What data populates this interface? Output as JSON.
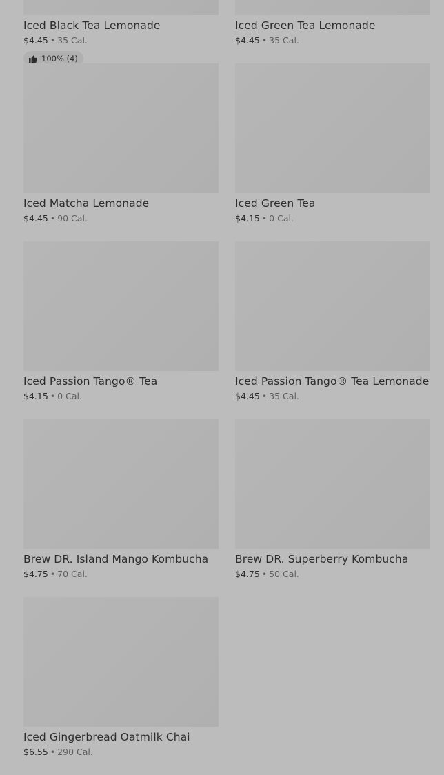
{
  "colors": {
    "background": "#bcbcbc",
    "thumbnail": "#b4b4b4",
    "text": "#2d2d2d",
    "muted": "#5e5e5e"
  },
  "products": [
    {
      "name": "Iced Black Tea Lemonade",
      "price": "$4.45",
      "separator": "•",
      "calories": "35 Cal.",
      "rating_icon": "thumbs-up-icon",
      "rating": "100% (4)"
    },
    {
      "name": "Iced Green Tea Lemonade",
      "price": "$4.45",
      "separator": "•",
      "calories": "35 Cal."
    },
    {
      "name": "Iced Matcha Lemonade",
      "price": "$4.45",
      "separator": "•",
      "calories": "90 Cal."
    },
    {
      "name": "Iced Green Tea",
      "price": "$4.15",
      "separator": "•",
      "calories": "0 Cal."
    },
    {
      "name": "Iced Passion Tango® Tea",
      "price": "$4.15",
      "separator": "•",
      "calories": "0 Cal."
    },
    {
      "name": "Iced Passion Tango® Tea Lemonade",
      "price": "$4.45",
      "separator": "•",
      "calories": "35 Cal."
    },
    {
      "name": "Brew DR. Island Mango Kombucha",
      "price": "$4.75",
      "separator": "•",
      "calories": "70 Cal."
    },
    {
      "name": "Brew DR. Superberry Kombucha",
      "price": "$4.75",
      "separator": "•",
      "calories": "50 Cal."
    },
    {
      "name": "Iced Gingerbread Oatmilk Chai",
      "price": "$6.55",
      "separator": "•",
      "calories": "290 Cal."
    }
  ]
}
